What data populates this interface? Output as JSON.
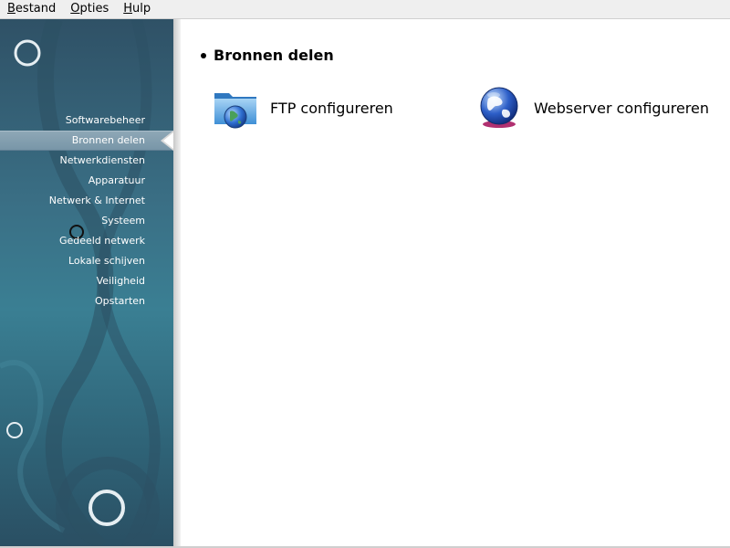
{
  "menubar": {
    "items": [
      {
        "label_mnemonic": "B",
        "label_rest": "estand"
      },
      {
        "label_mnemonic": "O",
        "label_rest": "pties"
      },
      {
        "label_mnemonic": "H",
        "label_rest": "ulp"
      }
    ]
  },
  "sidebar": {
    "items": [
      {
        "label": "Softwarebeheer"
      },
      {
        "label": "Bronnen delen",
        "active": true
      },
      {
        "label": "Netwerkdiensten"
      },
      {
        "label": "Apparatuur"
      },
      {
        "label": "Netwerk & Internet"
      },
      {
        "label": "Systeem"
      },
      {
        "label": "Gedeeld netwerk"
      },
      {
        "label": "Lokale schijven"
      },
      {
        "label": "Veiligheid"
      },
      {
        "label": "Opstarten"
      }
    ]
  },
  "main": {
    "section_title": "Bronnen delen",
    "tools": [
      {
        "label": "FTP configureren",
        "icon": "ftp-folder-globe-icon"
      },
      {
        "label": "Webserver configureren",
        "icon": "webserver-globe-icon"
      }
    ]
  },
  "colors": {
    "sidebar_base": "#3a6f85",
    "sidebar_active": "#8ea7b6",
    "content_bg": "#ffffff"
  }
}
